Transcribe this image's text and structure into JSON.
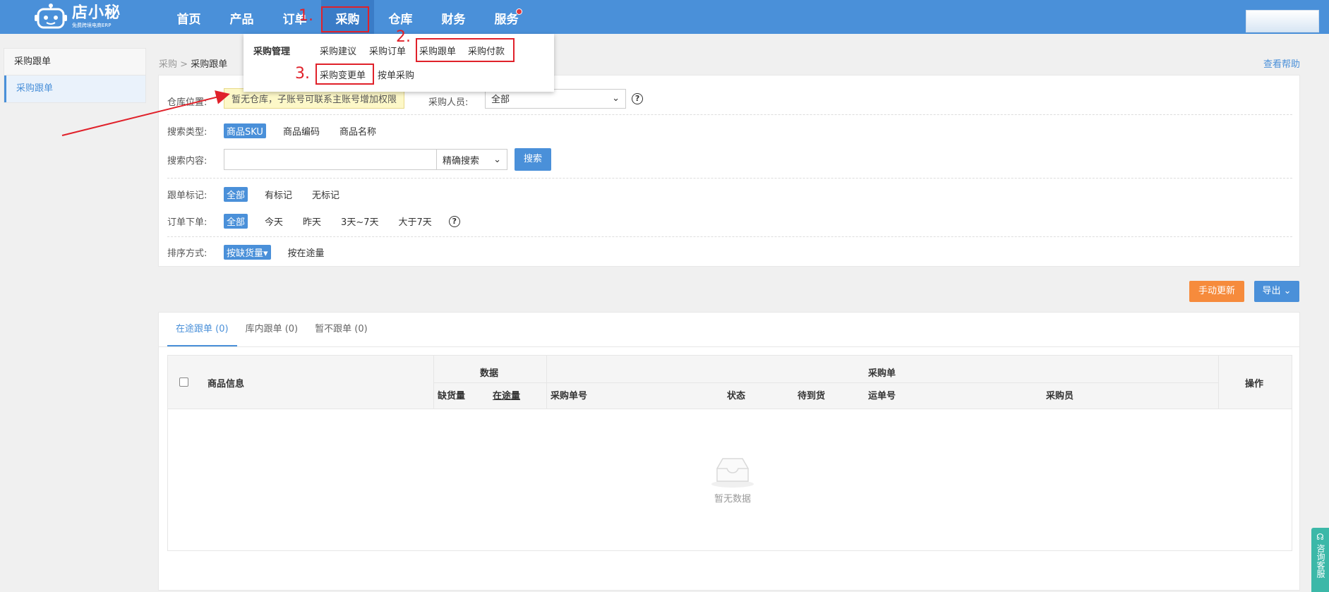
{
  "logo": {
    "main": "店小秘",
    "sub": "免费跨境电商ERP"
  },
  "nav": {
    "items": [
      {
        "label": "首页"
      },
      {
        "label": "产品"
      },
      {
        "label": "订单"
      },
      {
        "label": "采购"
      },
      {
        "label": "仓库"
      },
      {
        "label": "财务"
      },
      {
        "label": "服务"
      }
    ]
  },
  "annotations": {
    "n1": "1.",
    "n2": "2.",
    "n3": "3."
  },
  "dropdown": {
    "title": "采购管理",
    "items": [
      "采购建议",
      "采购订单",
      "采购跟单",
      "采购付款",
      "采购变更单",
      "按单采购"
    ]
  },
  "sidebar": {
    "title": "采购跟单",
    "item": "采购跟单"
  },
  "breadcrumb": {
    "parent": "采购",
    "sep": ">",
    "current": "采购跟单"
  },
  "help_link": "查看帮助",
  "filters": {
    "warehouse": {
      "label": "仓库位置:",
      "notice": "暂无仓库，子账号可联系主账号增加权限"
    },
    "buyer": {
      "label": "采购人员:",
      "value": "全部"
    },
    "search_type": {
      "label": "搜索类型:",
      "options": [
        "商品SKU",
        "商品编码",
        "商品名称"
      ]
    },
    "search_content": {
      "label": "搜索内容:",
      "placeholder": "",
      "mode": "精确搜索",
      "button": "搜索"
    },
    "tag": {
      "label": "跟单标记:",
      "options": [
        "全部",
        "有标记",
        "无标记"
      ]
    },
    "order_date": {
      "label": "订单下单:",
      "options": [
        "全部",
        "今天",
        "昨天",
        "3天~7天",
        "大于7天"
      ]
    },
    "sort": {
      "label": "排序方式:",
      "options": [
        "按缺货量▾",
        "按在途量"
      ]
    }
  },
  "actions": {
    "manual_update": "手动更新",
    "export": "导出"
  },
  "tabs": [
    "在途跟单 (0)",
    "库内跟单 (0)",
    "暂不跟单 (0)"
  ],
  "table": {
    "product_info": "商品信息",
    "group_data": "数据",
    "group_po": "采购单",
    "operation": "操作",
    "cols": {
      "shortage": "缺货量",
      "in_transit": "在途量",
      "po_no": "采购单号",
      "status": "状态",
      "pending": "待到货",
      "tracking": "运单号",
      "buyer": "采购员"
    },
    "empty": "暂无数据"
  },
  "float_service": "咨询客服",
  "colors": {
    "primary": "#4a90d9",
    "orange": "#f68b3c",
    "annotation": "#e0212a"
  }
}
